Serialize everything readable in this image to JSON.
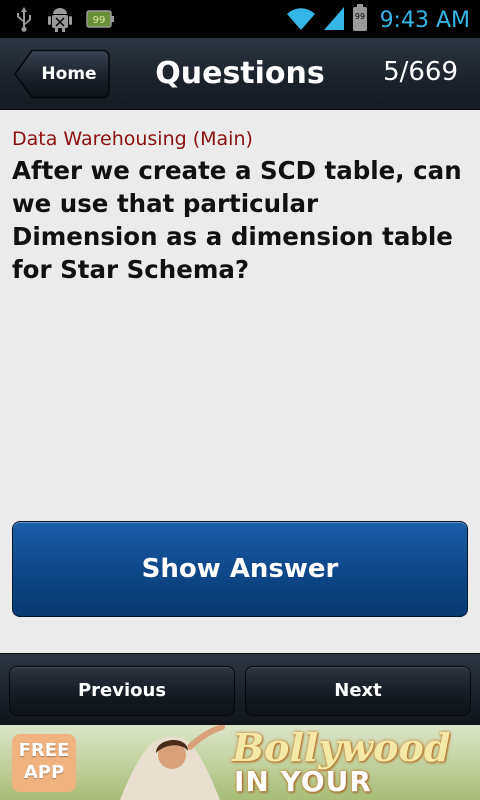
{
  "status_bar": {
    "time": "9:43 AM",
    "battery_level": "99",
    "icons": [
      "usb-icon",
      "android-debug-icon",
      "battery-small-icon",
      "wifi-icon",
      "signal-icon",
      "battery-icon"
    ],
    "accent_color": "#33b5e5"
  },
  "header": {
    "home_label": "Home",
    "title": "Questions",
    "counter": "5/669"
  },
  "question": {
    "category": "Data Warehousing (Main)",
    "text": "After we create a SCD table, can we use that particular Dimension as a dimension table for Star Schema?",
    "show_answer_label": "Show Answer"
  },
  "nav": {
    "previous_label": "Previous",
    "next_label": "Next"
  },
  "ad": {
    "badge": "FREE APP",
    "line1": "Bollywood",
    "line2": "IN YOUR POCKET"
  },
  "colors": {
    "category_text": "#8b1010",
    "content_bg": "#ebebeb",
    "answer_button": "#0f4a8c",
    "bar_bg": "#1b222b"
  }
}
